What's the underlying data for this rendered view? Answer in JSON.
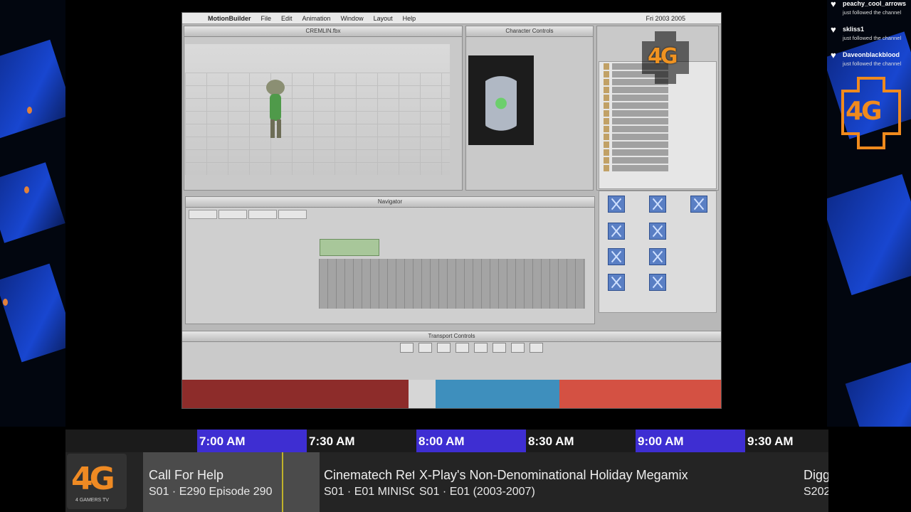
{
  "software": {
    "menubar": [
      "MotionBuilder",
      "File",
      "Edit",
      "Animation",
      "Window",
      "Layout",
      "Help"
    ],
    "clock": "Fri 2003 2005",
    "viewer_title": "CREMLIN.fbx",
    "panel_title": "Character Controls",
    "navigator_title": "Navigator",
    "transport_title": "Transport Controls"
  },
  "watermark": {
    "logo_text": "4G"
  },
  "chat": [
    {
      "user": "peachy_cool_arrows",
      "message": "just followed the channel"
    },
    {
      "user": "skliss1",
      "message": "just followed the channel"
    },
    {
      "user": "Daveonblackblood",
      "message": "just followed the channel"
    }
  ],
  "side_logo": {
    "text": "4G"
  },
  "guide": {
    "times": [
      "7:00 AM",
      "7:30 AM",
      "8:00 AM",
      "8:30 AM",
      "9:00 AM",
      "9:30 AM"
    ],
    "channel": {
      "logo": "4G",
      "name": "4 GAMERS TV"
    },
    "programs": [
      {
        "title": "Call For Help",
        "episode": "S01 · E290 Episode 290"
      },
      {
        "title": "Cinematech Ret",
        "episode": "S01 · E01 MINISC"
      },
      {
        "title": "X-Play's Non-Denominational Holiday Megamix",
        "episode": "S01 · E01 (2003-2007)"
      },
      {
        "title": "Digg",
        "episode": "S202"
      }
    ]
  },
  "colors": {
    "accent": "#3e2ed2",
    "brand": "#ef8a23"
  }
}
